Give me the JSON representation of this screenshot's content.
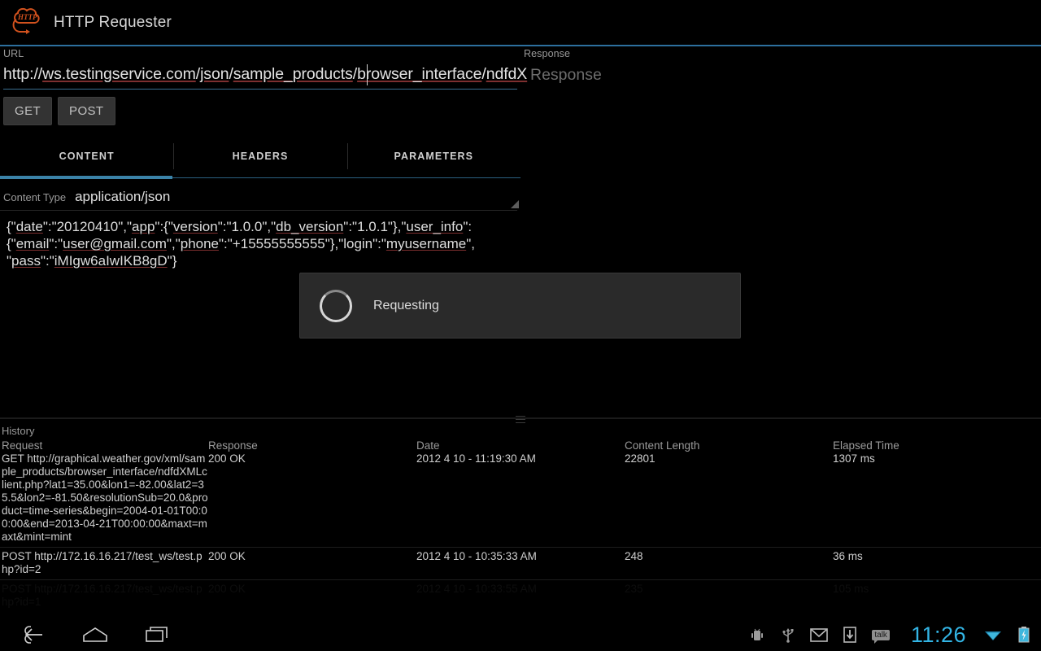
{
  "app": {
    "title": "HTTP Requester",
    "logo_icon": "http-cloud-logo"
  },
  "request": {
    "url_label": "URL",
    "url_value": "http://ws.testingservice.com/json/sample_products/browser_interface/ndfdX",
    "methods": [
      {
        "label": "GET",
        "name": "get-button"
      },
      {
        "label": "POST",
        "name": "post-button"
      }
    ]
  },
  "response": {
    "label": "Response",
    "placeholder": "Response"
  },
  "tabs": [
    {
      "label": "CONTENT",
      "active": true
    },
    {
      "label": "HEADERS",
      "active": false
    },
    {
      "label": "PARAMETERS",
      "active": false
    }
  ],
  "content": {
    "content_type_label": "Content Type",
    "content_type_value": "application/json",
    "dropdown_icon": "spinner-triangle-icon",
    "body": "{\"date\":\"20120410\",\"app\":{\"version\":\"1.0.0\",\"db_version\":\"1.0.1\"},\"user_info\":{\"email\":\"user@gmail.com\",\"phone\":\"+15555555555\"},\"login\":\"myusername\",\"pass\":\"iMIgw6aIwIKB8gD\"}"
  },
  "dialog": {
    "message": "Requesting",
    "spinner_icon": "loading-spinner-icon"
  },
  "history": {
    "title": "History",
    "columns": [
      "Request",
      "Response",
      "Date",
      "Content Length",
      "Elapsed Time"
    ],
    "rows": [
      {
        "request": "GET http://graphical.weather.gov/xml/sample_products/browser_interface/ndfdXMLclient.php?lat1=35.00&lon1=-82.00&lat2=35.5&lon2=-81.50&resolutionSub=20.0&product=time-series&begin=2004-01-01T00:00:00&end=2013-04-21T00:00:00&maxt=maxt&mint=mint",
        "response": "200 OK",
        "date": "2012 4 10 - 11:19:30 AM",
        "content_length": "22801",
        "elapsed": "1307 ms"
      },
      {
        "request": "POST http://172.16.16.217/test_ws/test.php?id=2",
        "response": "200 OK",
        "date": "2012 4 10 - 10:35:33 AM",
        "content_length": "248",
        "elapsed": "36 ms"
      },
      {
        "request": "POST http://172.16.16.217/test_ws/test.php?id=1",
        "response": "200 OK",
        "date": "2012 4 10 - 10:33:55 AM",
        "content_length": "235",
        "elapsed": "105 ms"
      }
    ]
  },
  "navbar": {
    "back_icon": "back-arrow-icon",
    "home_icon": "home-icon",
    "recents_icon": "recent-apps-icon",
    "status_icons": [
      "android-debug-icon",
      "usb-icon",
      "gmail-icon",
      "download-icon"
    ],
    "talk_label": "talk",
    "clock": "11:26",
    "wifi_icon": "wifi-icon",
    "battery_icon": "battery-charging-icon"
  },
  "colors": {
    "accent": "#33b5e5",
    "tab_underline": "#3b83a8",
    "actionbar_rule": "#2d6f9e",
    "logo": "#d2521e",
    "spell_underline": "#7d2f2f"
  }
}
